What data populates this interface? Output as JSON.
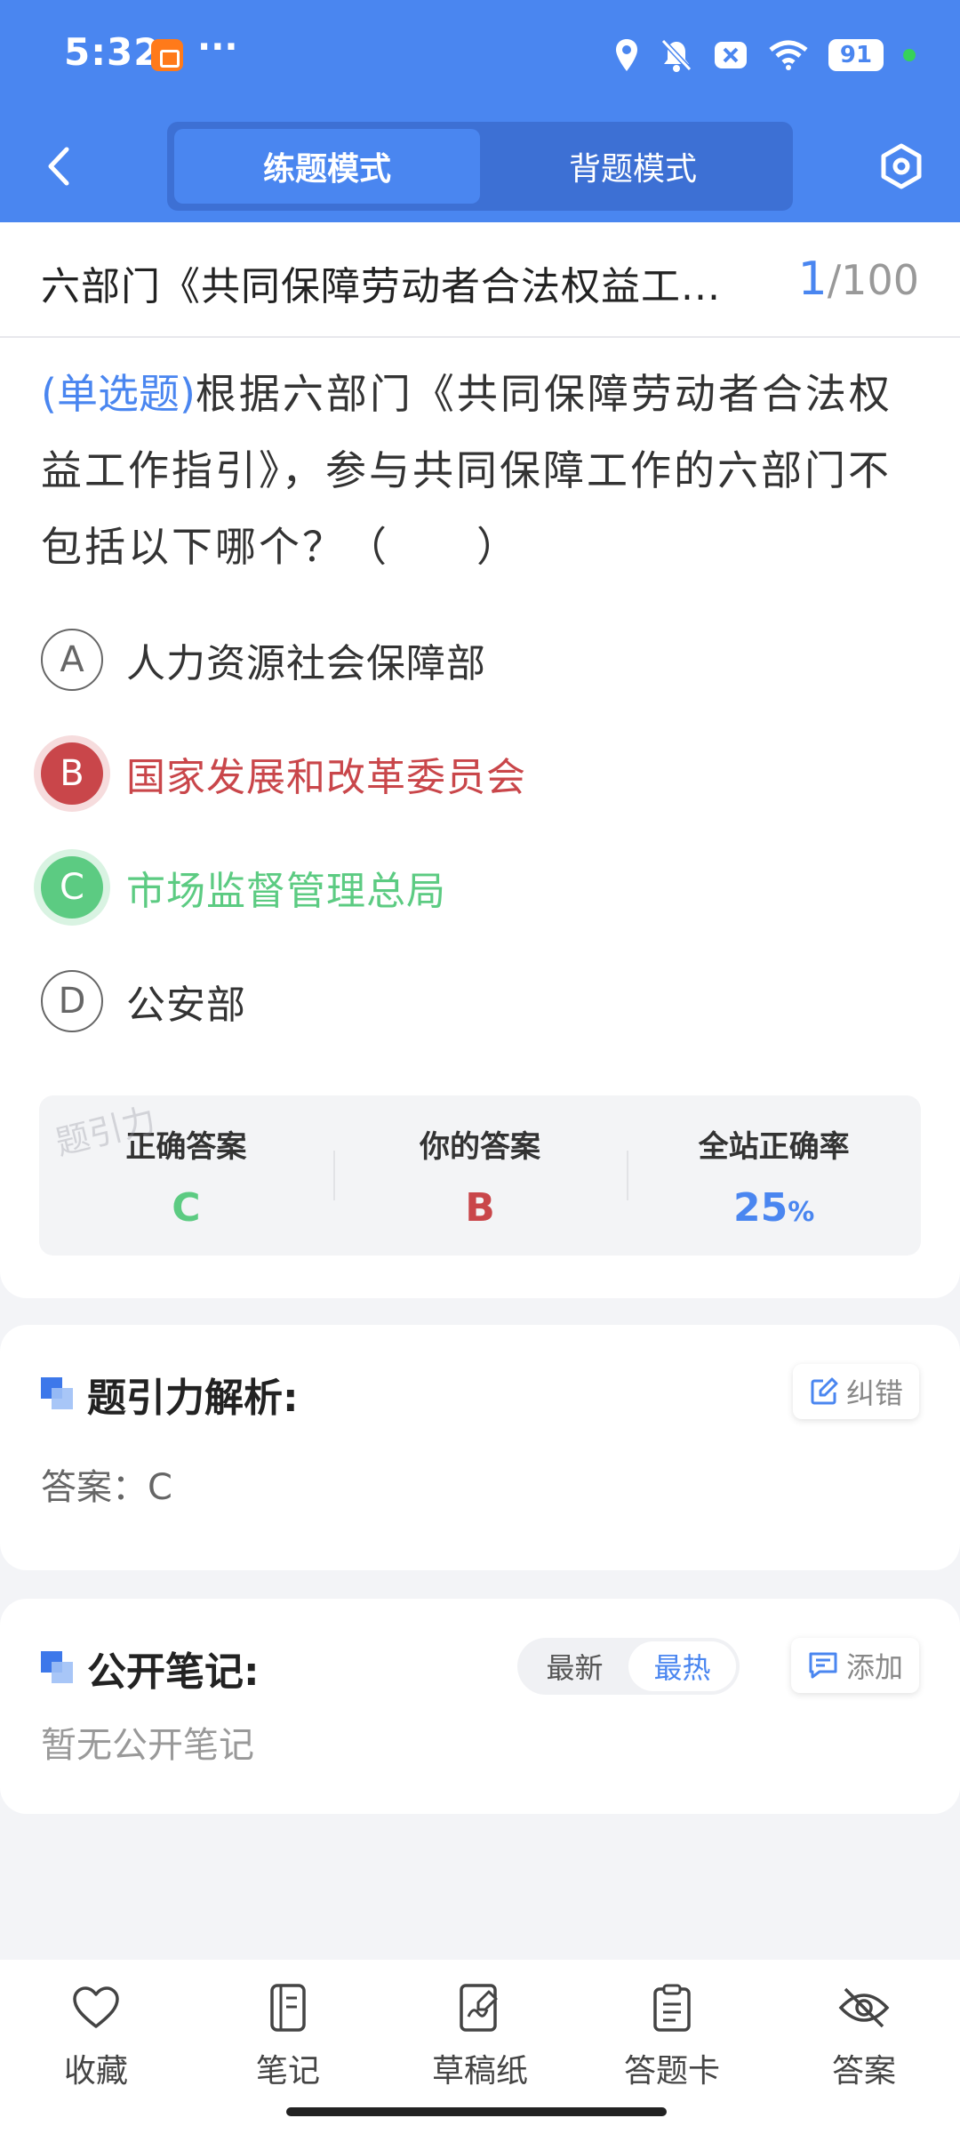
{
  "status_bar": {
    "time": "5:32",
    "more": "···",
    "battery": "91",
    "accent": "#4a86f0"
  },
  "nav": {
    "back_icon": "chevron-left-icon",
    "tabs": [
      {
        "label": "练题模式",
        "active": true
      },
      {
        "label": "背题模式",
        "active": false
      }
    ],
    "settings_icon": "settings-hexagon-icon"
  },
  "question": {
    "title": "六部门《共同保障劳动者合法权益工...",
    "current": "1",
    "total": "/100",
    "type": "(单选题)",
    "text": "根据六部门《共同保障劳动者合法权益工作指引》，参与共同保障工作的六部门不包括以下哪个？（　　）",
    "options": [
      {
        "letter": "A",
        "text": "人力资源社会保障部",
        "state": "normal"
      },
      {
        "letter": "B",
        "text": "国家发展和改革委员会",
        "state": "wrong"
      },
      {
        "letter": "C",
        "text": "市场监督管理总局",
        "state": "right"
      },
      {
        "letter": "D",
        "text": "公安部",
        "state": "normal"
      }
    ]
  },
  "result": {
    "watermark": "题引力",
    "correct_label": "正确答案",
    "correct_value": "C",
    "yours_label": "你的答案",
    "yours_value": "B",
    "rate_label": "全站正确率",
    "rate_value": "25",
    "rate_unit": "%",
    "colors": {
      "correct": "#5ccb82",
      "wrong": "#c9464a"
    }
  },
  "analysis": {
    "title": "题引力解析:",
    "fix_button": "纠错",
    "answer": "答案：C"
  },
  "notes": {
    "title": "公开笔记:",
    "sort_options": [
      {
        "label": "最新",
        "active": false
      },
      {
        "label": "最热",
        "active": true
      }
    ],
    "add_button": "添加",
    "empty": "暂无公开笔记"
  },
  "bottom_bar": [
    {
      "label": "收藏",
      "icon": "heart-icon"
    },
    {
      "label": "笔记",
      "icon": "notebook-icon"
    },
    {
      "label": "草稿纸",
      "icon": "draft-paper-icon"
    },
    {
      "label": "答题卡",
      "icon": "answer-card-icon"
    },
    {
      "label": "答案",
      "icon": "eye-off-icon"
    }
  ]
}
